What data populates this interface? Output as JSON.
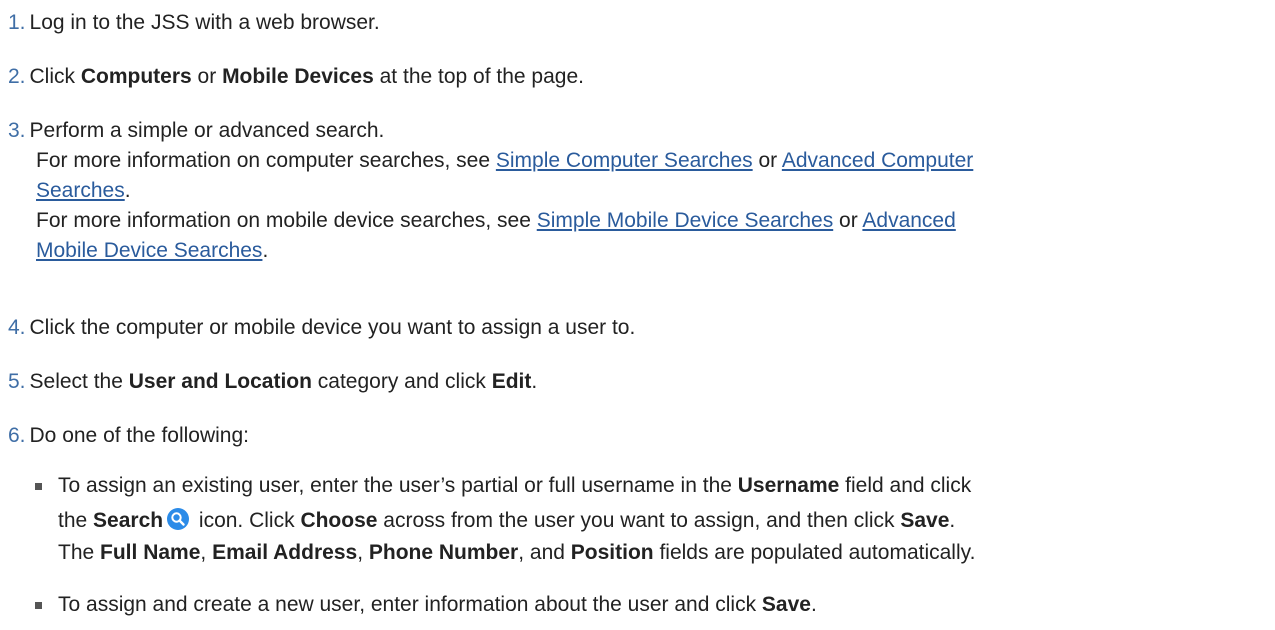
{
  "steps": [
    {
      "num": "1.",
      "text": "Log in to the JSS with a web browser."
    },
    {
      "num": "2.",
      "pre": "Click ",
      "bold1": "Computers",
      "mid": " or ",
      "bold2": "Mobile Devices",
      "post": " at the top of the page."
    },
    {
      "num": "3.",
      "text": "Perform a simple or advanced search.",
      "computer_line_pre": "For more information on computer searches, see ",
      "link_simple_computer": "Simple Computer Searches",
      "or1": " or ",
      "link_advanced_computer_a": "Advanced Computer",
      "link_advanced_computer_b": "Searches",
      "period1": ".",
      "mobile_line_pre": "For more information on mobile device searches, see ",
      "link_simple_mobile": "Simple Mobile Device Searches",
      "or2": " or ",
      "link_advanced_mobile_a": "Advanced",
      "link_advanced_mobile_b": "Mobile Device Searches",
      "period2": "."
    },
    {
      "num": "4.",
      "text": "Click the computer or mobile device you want to assign a user to."
    },
    {
      "num": "5.",
      "pre": "Select the ",
      "bold1": "User and Location",
      "mid": " category and click ",
      "bold2": "Edit",
      "post": "."
    },
    {
      "num": "6.",
      "text": "Do one of the following:"
    }
  ],
  "bullets": [
    {
      "pre": "To assign an existing user, enter the user’s partial or full username in the ",
      "b_username": "Username",
      "post1": " field and click",
      "the": "the ",
      "b_search": "Search",
      "search_icon": "search-icon",
      "icon_post": " icon. Click ",
      "b_choose": "Choose",
      "choose_post": " across from the user you want to assign, and then click ",
      "b_save": "Save",
      "dot": ".",
      "the2": "The ",
      "b_full_name": "Full Name",
      "c1": ", ",
      "b_email": "Email Address",
      "c2": ", ",
      "b_phone": "Phone Number",
      "c3": ", and ",
      "b_position": "Position",
      "final": " fields are populated automatically."
    },
    {
      "pre": "To assign and create a new user, enter information about the user and click ",
      "b_save": "Save",
      "dot": "."
    }
  ],
  "colors": {
    "step_number": "#3f6ea6",
    "link": "#2a5b9c",
    "icon": "#2b8be8"
  }
}
